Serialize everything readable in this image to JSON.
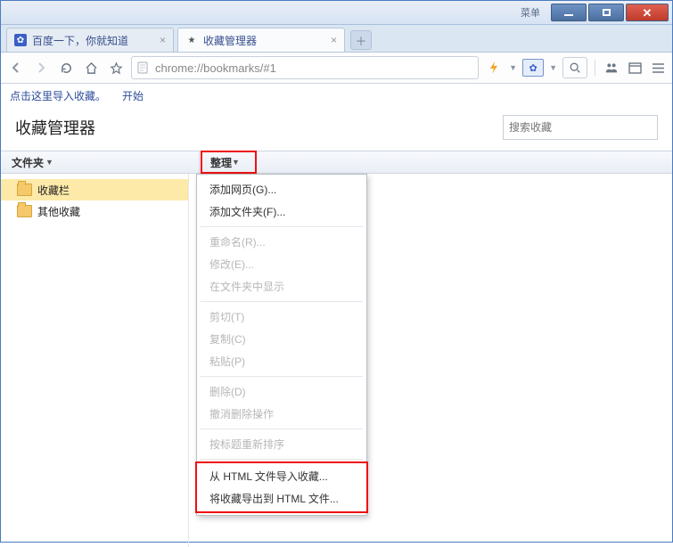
{
  "window": {
    "menu_label": "菜单"
  },
  "tabs": [
    {
      "title": "百度一下，你就知道",
      "favicon": "paw"
    },
    {
      "title": "收藏管理器",
      "favicon": "star"
    }
  ],
  "toolbar": {
    "url": "chrome://bookmarks/#1"
  },
  "bookmark_bar": {
    "hint": "点击这里导入收藏。",
    "start": "开始"
  },
  "page": {
    "title": "收藏管理器",
    "search_placeholder": "搜索收藏"
  },
  "columns": {
    "folders": "文件夹",
    "organize": "整理"
  },
  "folders": [
    {
      "label": "收藏栏",
      "selected": true
    },
    {
      "label": "其他收藏",
      "selected": false
    }
  ],
  "dropdown": {
    "add_page": "添加网页(G)...",
    "add_folder": "添加文件夹(F)...",
    "rename": "重命名(R)...",
    "edit": "修改(E)...",
    "show_in_folder": "在文件夹中显示",
    "cut": "剪切(T)",
    "copy": "复制(C)",
    "paste": "粘贴(P)",
    "delete": "删除(D)",
    "undo_delete": "撤消删除操作",
    "sort_by_title": "按标题重新排序",
    "import": "从 HTML 文件导入收藏...",
    "export": "将收藏导出到 HTML 文件..."
  }
}
